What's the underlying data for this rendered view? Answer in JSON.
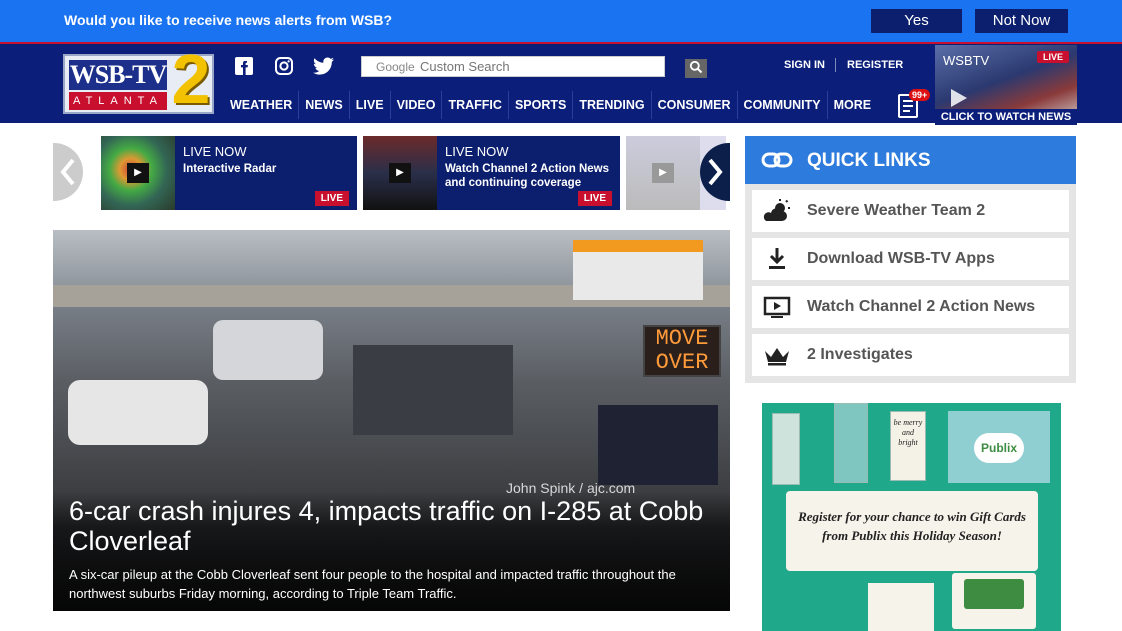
{
  "alert": {
    "text": "Would you like to receive news alerts from WSB?",
    "yes_label": "Yes",
    "no_label": "Not Now"
  },
  "header": {
    "logo": {
      "top": "WSB-TV",
      "bottom": "ATLANTA",
      "number": "2"
    },
    "search": {
      "placeholder": "Custom Search",
      "brand": "Google"
    },
    "sign_in": "SIGN IN",
    "register": "REGISTER",
    "nav": [
      "WEATHER",
      "NEWS",
      "LIVE",
      "VIDEO",
      "TRAFFIC",
      "SPORTS",
      "TRENDING",
      "CONSUMER",
      "COMMUNITY",
      "MORE"
    ],
    "notification_count": "99+",
    "live_promo": {
      "brand": "WSBTV",
      "badge": "LIVE",
      "cta": "CLICK TO WATCH NEWS"
    }
  },
  "carousel": {
    "items": [
      {
        "status": "LIVE NOW",
        "title": "Interactive Radar",
        "badge": "LIVE"
      },
      {
        "status": "LIVE NOW",
        "title": "Watch Channel 2 Action News and continuing coverage",
        "badge": "LIVE"
      }
    ]
  },
  "hero": {
    "sign_text": "MOVE OVER",
    "credit": "John Spink / ajc.com",
    "title": "6-car crash injures 4, impacts traffic on I-285 at Cobb Cloverleaf",
    "summary": "A six-car pileup at the Cobb Cloverleaf sent four people to the hospital and impacted traffic throughout the northwest suburbs Friday morning, according to Triple Team Traffic."
  },
  "quick_links": {
    "title": "QUICK LINKS",
    "items": [
      {
        "label": "Severe Weather Team 2",
        "icon": "weather-icon"
      },
      {
        "label": "Download WSB-TV Apps",
        "icon": "download-icon"
      },
      {
        "label": "Watch Channel 2 Action News",
        "icon": "play-screen-icon"
      },
      {
        "label": "2 Investigates",
        "icon": "crown-icon"
      }
    ]
  },
  "ad": {
    "headline": "Register for your chance to win Gift Cards from Publix this Holiday Season!",
    "brand": "Publix",
    "tag_text": "be merry and bright"
  },
  "colors": {
    "alert_bg": "#1a73f0",
    "header_bg": "#0b1f7a",
    "accent_red": "#c8102e",
    "quick_links_header": "#2d7bdc"
  }
}
